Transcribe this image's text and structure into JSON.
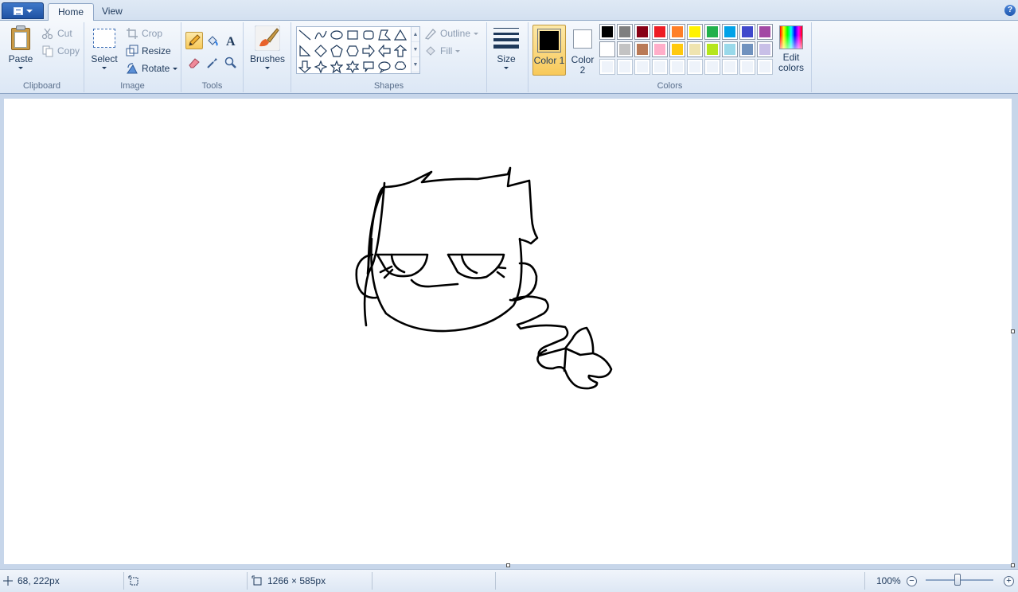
{
  "tabs": [
    {
      "label": "Home",
      "active": true
    },
    {
      "label": "View",
      "active": false
    }
  ],
  "app_menu": {
    "icon": "app-menu-icon"
  },
  "help": {
    "label": "?"
  },
  "clipboard": {
    "group_label": "Clipboard",
    "paste": "Paste",
    "cut": "Cut",
    "copy": "Copy"
  },
  "image": {
    "group_label": "Image",
    "select": "Select",
    "crop": "Crop",
    "resize": "Resize",
    "rotate": "Rotate"
  },
  "tools": {
    "group_label": "Tools",
    "items": [
      "pencil-icon",
      "fill-bucket-icon",
      "text-icon",
      "eraser-icon",
      "color-picker-icon",
      "magnifier-icon"
    ]
  },
  "brushes": {
    "label": "Brushes"
  },
  "shapes": {
    "group_label": "Shapes",
    "outline": "Outline",
    "fill": "Fill"
  },
  "size": {
    "label": "Size"
  },
  "colors": {
    "group_label": "Colors",
    "color1_label": "Color 1",
    "color1_value": "#000000",
    "color2_label": "Color 2",
    "color2_value": "#ffffff",
    "edit_colors": "Edit colors",
    "palette_row1": [
      "#000000",
      "#7f7f7f",
      "#880015",
      "#ed1c24",
      "#ff7f27",
      "#fff200",
      "#22b14c",
      "#00a2e8",
      "#3f48cc",
      "#a349a4"
    ],
    "palette_row2": [
      "#ffffff",
      "#c3c3c3",
      "#b97a57",
      "#ffaec9",
      "#ffc90e",
      "#efe4b0",
      "#b5e61d",
      "#99d9ea",
      "#7092be",
      "#c8bfe7"
    ]
  },
  "status": {
    "cursor_pos": "68, 222px",
    "canvas_size": "1266 × 585px",
    "zoom": "100%",
    "zoom_level": 1.0
  }
}
